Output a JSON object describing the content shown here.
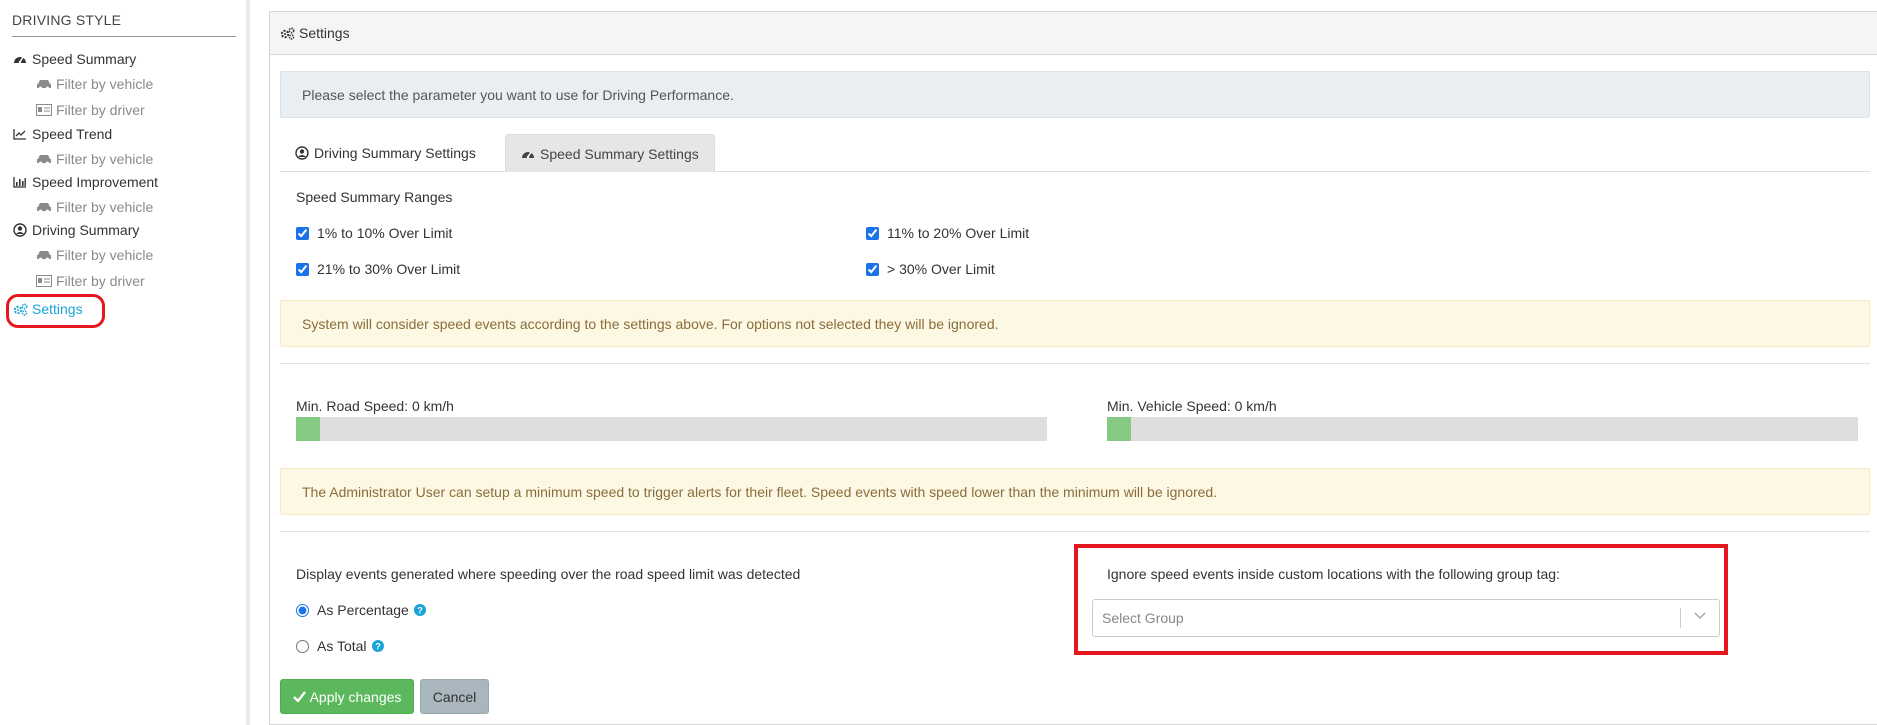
{
  "sidebar": {
    "heading": "DRIVING STYLE",
    "speed_summary": "Speed Summary",
    "speed_summary_vehicle": "Filter by vehicle",
    "speed_summary_driver": "Filter by driver",
    "speed_trend": "Speed Trend",
    "speed_trend_vehicle": "Filter by vehicle",
    "speed_improvement": "Speed Improvement",
    "speed_improvement_vehicle": "Filter by vehicle",
    "driving_summary": "Driving Summary",
    "driving_summary_vehicle": "Filter by vehicle",
    "driving_summary_driver": "Filter by driver",
    "settings": "Settings"
  },
  "panel": {
    "title": "Settings",
    "info": "Please select the parameter you want to use for Driving Performance.",
    "tabs": [
      {
        "label": "Driving Summary Settings"
      },
      {
        "label": "Speed Summary Settings"
      }
    ],
    "ranges_label": "Speed Summary Ranges",
    "ranges": [
      {
        "label": "1% to 10% Over Limit",
        "checked": true
      },
      {
        "label": "11% to 20% Over Limit",
        "checked": true
      },
      {
        "label": "21% to 30% Over Limit",
        "checked": true
      },
      {
        "label": "> 30% Over Limit",
        "checked": true
      }
    ],
    "ranges_note": "System will consider speed events according to the settings above. For options not selected they will be ignored.",
    "min_road_speed_label": "Min. Road Speed: 0 km/h",
    "min_road_speed_value": 0,
    "min_vehicle_speed_label": "Min. Vehicle Speed: 0 km/h",
    "min_vehicle_speed_value": 0,
    "speed_note": "The Administrator User can setup a minimum speed to trigger alerts for their fleet. Speed events with speed lower than the minimum will be ignored.",
    "display_label": "Display events generated where speeding over the road speed limit was detected",
    "display_options": [
      {
        "label": "As Percentage",
        "selected": true
      },
      {
        "label": "As Total",
        "selected": false
      }
    ],
    "ignore_label": "Ignore speed events inside custom locations with the following group tag:",
    "group_placeholder": "Select Group",
    "apply_label": "Apply changes",
    "cancel_label": "Cancel"
  },
  "colors": {
    "accent": "#1aa3d8",
    "apply": "#5cb85c",
    "annotation": "#e4161e",
    "slider_fill": "#86c983"
  }
}
